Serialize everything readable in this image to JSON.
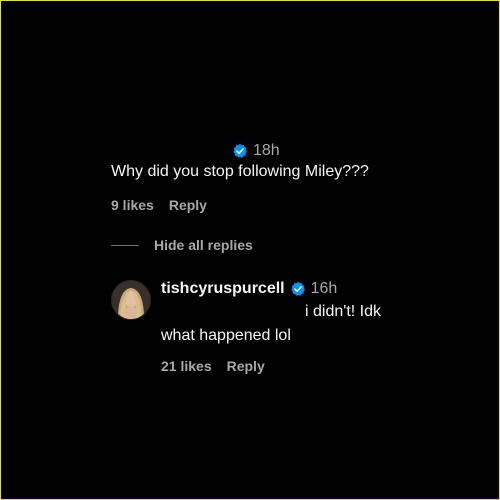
{
  "parent_comment": {
    "verified_icon": "verified-badge-icon",
    "time": "18h",
    "text": "Why did you stop following Miley???",
    "likes": "9 likes",
    "reply_label": "Reply"
  },
  "hide_replies": {
    "label": "Hide all replies"
  },
  "reply": {
    "avatar_icon": "user-avatar",
    "username": "tishcyruspurcell",
    "verified_icon": "verified-badge-icon",
    "time": "16h",
    "text_line1": "i didn't! Idk",
    "text_line2": "what happened lol",
    "likes": "21 likes",
    "reply_label": "Reply"
  },
  "colors": {
    "background": "#000000",
    "border": "#e6e600",
    "verified_blue": "#0095f6",
    "muted_text": "#a8a8a8"
  }
}
